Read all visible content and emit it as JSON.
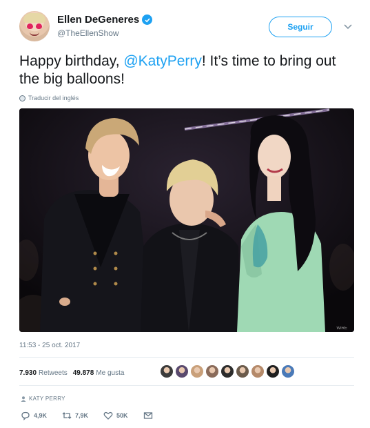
{
  "author": {
    "name": "Ellen DeGeneres",
    "handle": "@TheEllenShow",
    "verified": true
  },
  "follow_button": {
    "label": "Seguir"
  },
  "tweet": {
    "text_before": "Happy birthday, ",
    "mention": "@KatyPerry",
    "text_after": "! It’s time to bring out the big balloons!",
    "translate_label": "Traducir del inglés",
    "timestamp": "11:53 - 25 oct. 2017"
  },
  "stats": {
    "retweets_count": "7.930",
    "retweets_label": "Retweets",
    "likes_count": "49.878",
    "likes_label": "Me gusta",
    "liker_colors": [
      "#3b3b3b",
      "#5a4a6e",
      "#c9a07a",
      "#8a6b5a",
      "#2c2c2c",
      "#6b5b4b",
      "#b58a6a",
      "#1f1f1f",
      "#4a7ab8"
    ]
  },
  "context": {
    "tagged": "KATY PERRY"
  },
  "actions": {
    "reply_count": "4,9K",
    "retweet_count": "7,9K",
    "like_count": "50K"
  },
  "colors": {
    "accent": "#1da1f2",
    "text": "#14171a",
    "muted": "#657786"
  }
}
